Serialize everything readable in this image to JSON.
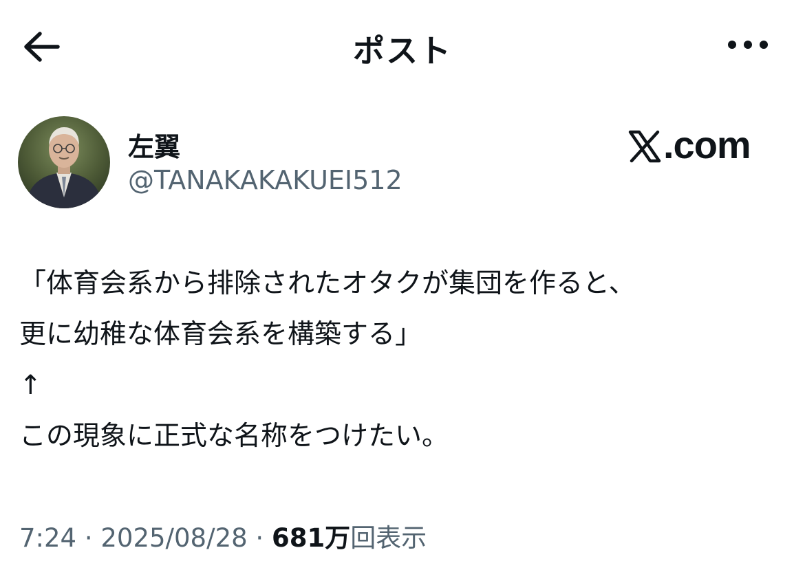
{
  "header": {
    "title": "ポスト"
  },
  "author": {
    "display_name": "左翼",
    "handle": "@TANAKAKAKUEI512"
  },
  "watermark": {
    "text": ".com"
  },
  "tweet": {
    "lines": [
      "「体育会系から排除されたオタクが集団を作ると、",
      "更に幼稚な体育会系を構築する」",
      "↑",
      "この現象に正式な名称をつけたい。"
    ]
  },
  "meta": {
    "time": "7:24",
    "separator": " · ",
    "date": "2025/08/28",
    "views_count": "681万",
    "views_label": "回表示"
  }
}
